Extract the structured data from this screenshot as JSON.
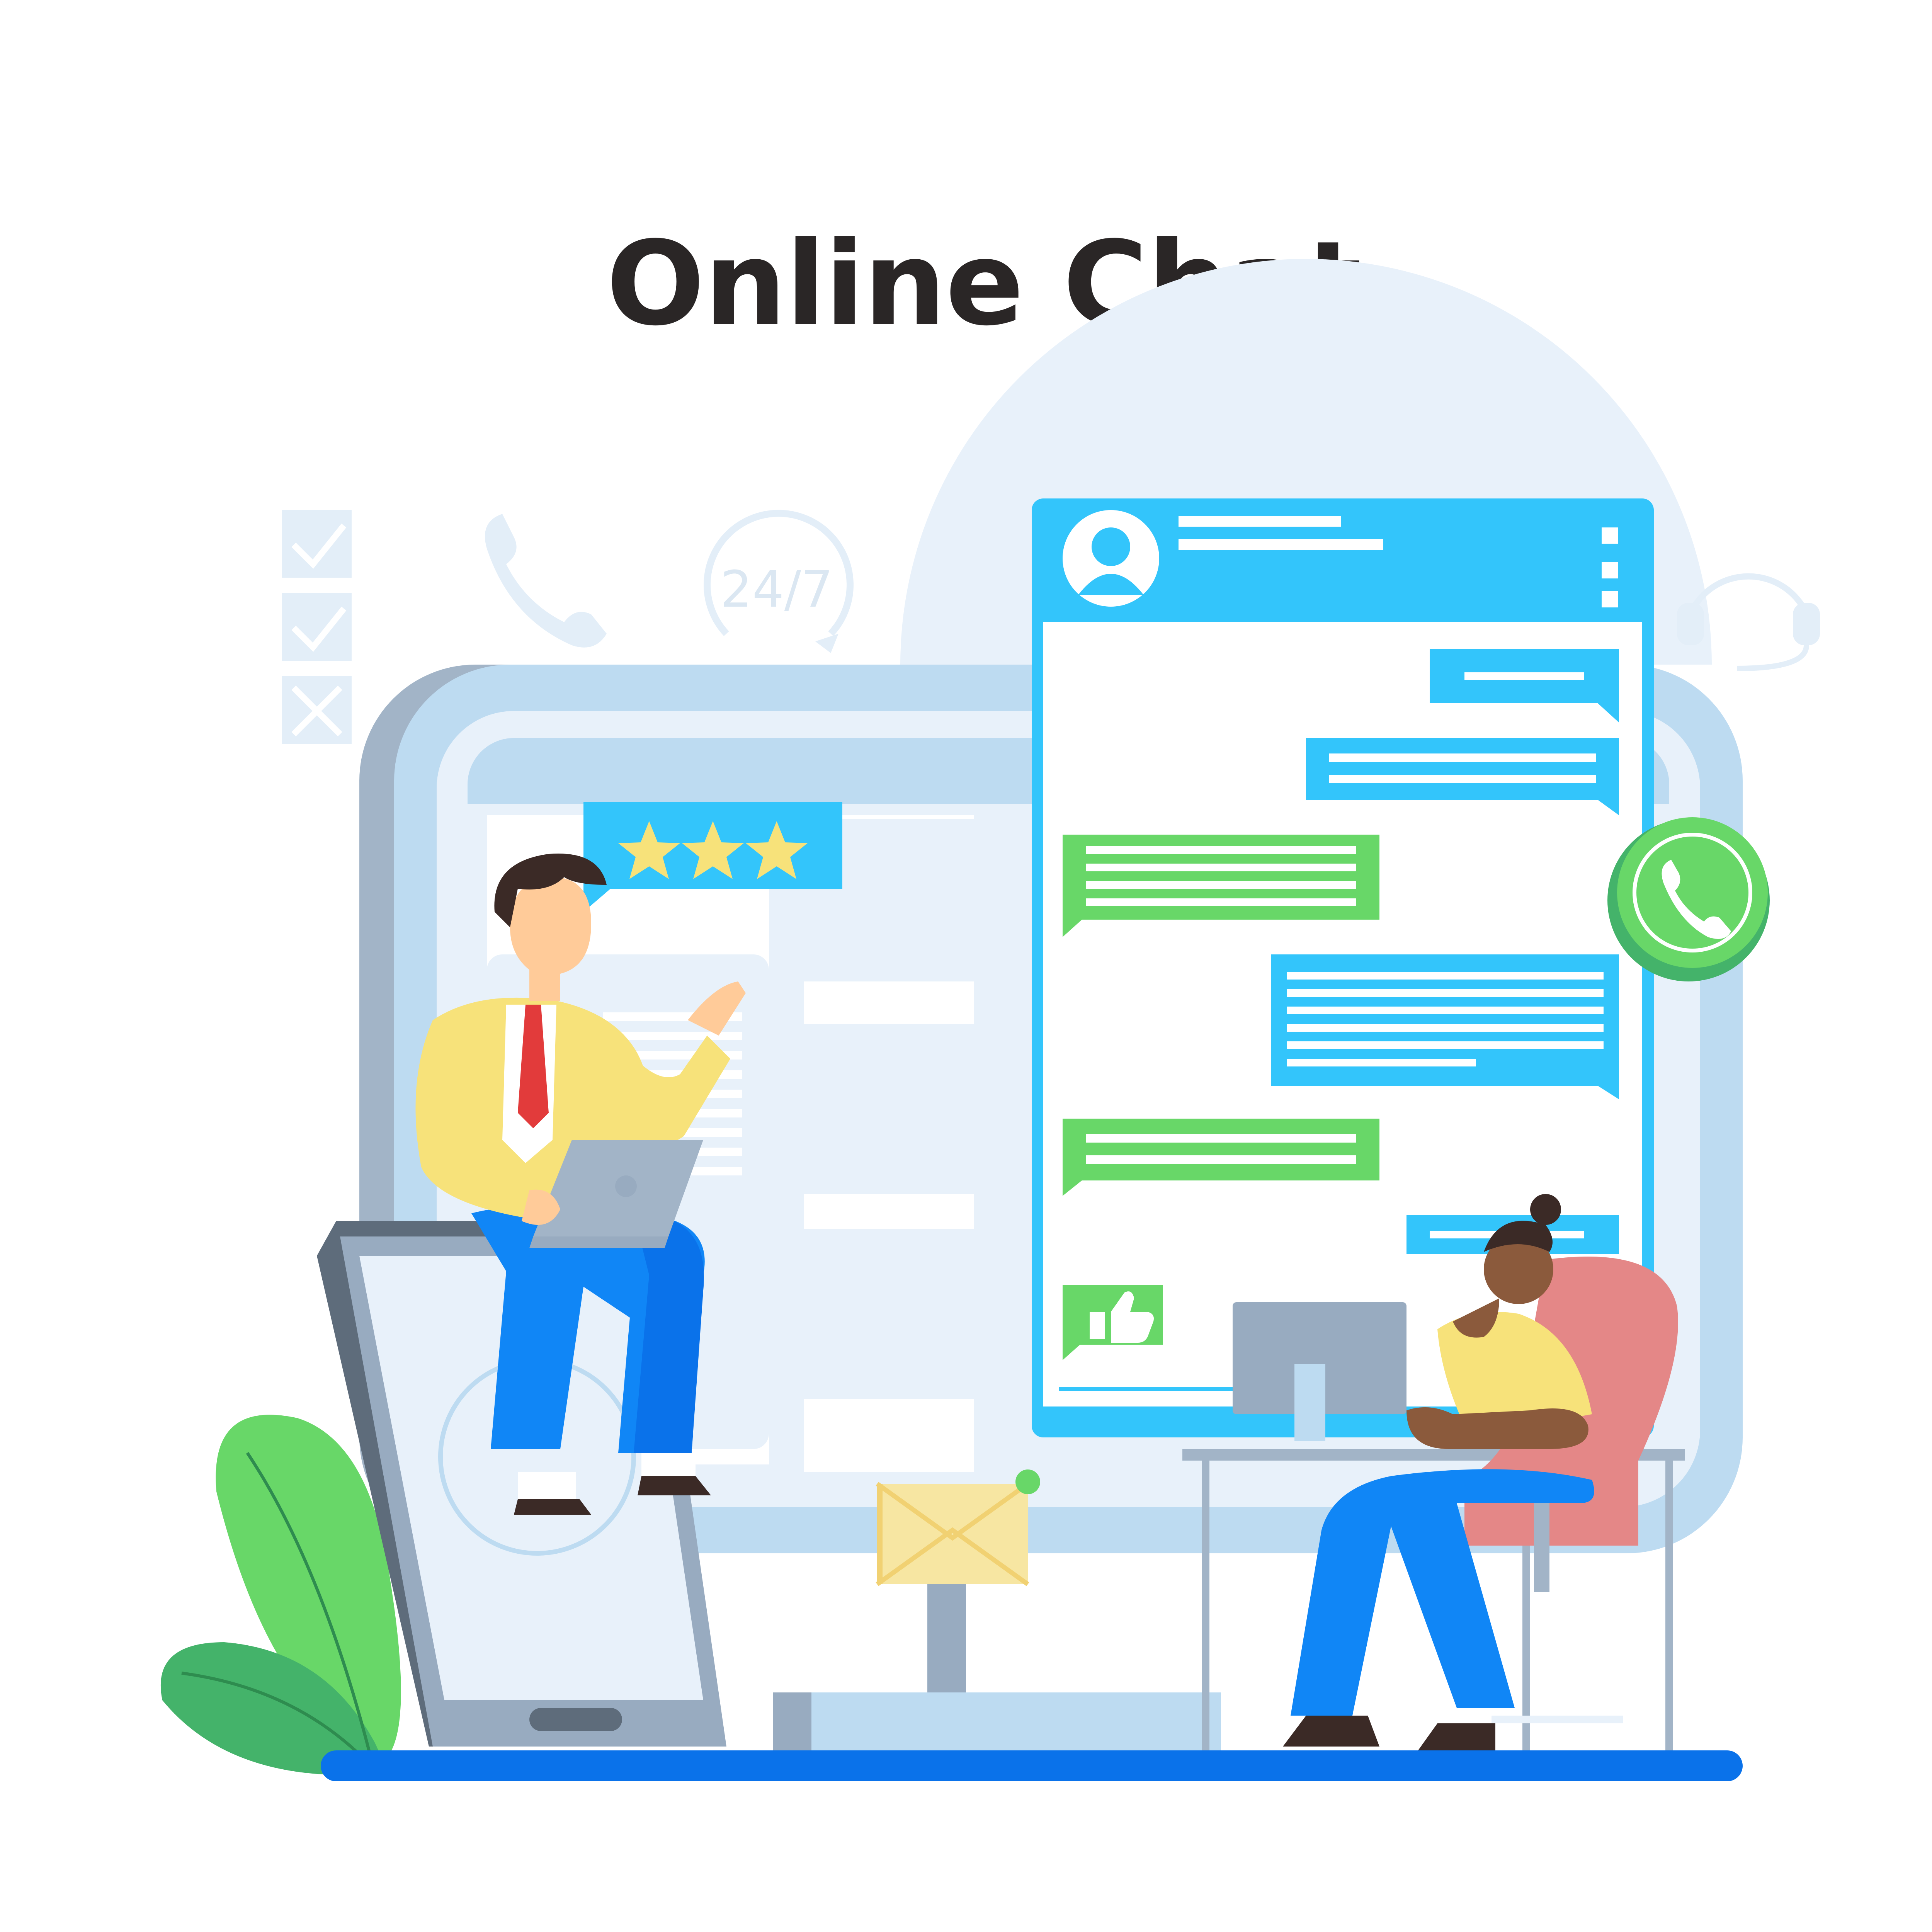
{
  "title": "Online Chat",
  "icons": {
    "badge_24_7": "24/7",
    "search_glyph": "Q"
  },
  "rating": {
    "stars": 3,
    "max": 3
  },
  "colors": {
    "chat_header": "#33c5fb",
    "bubble_blue": "#33c5fb",
    "bubble_green": "#68d768",
    "phone_green": "#68d768",
    "floor": "#0a72ea",
    "tablet_light": "#bddbf1",
    "title": "#2a2626"
  }
}
